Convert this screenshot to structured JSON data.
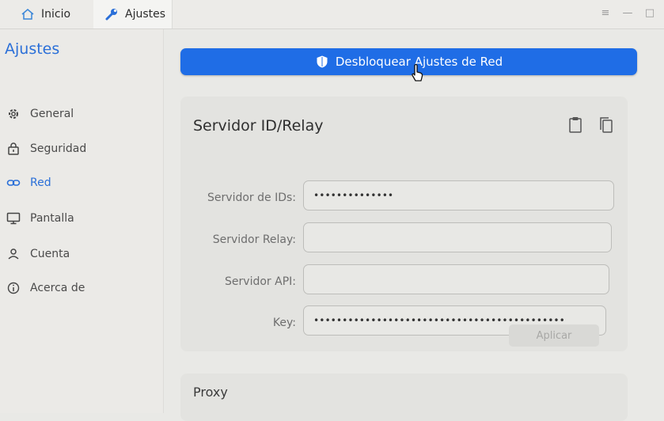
{
  "tabs": [
    {
      "label": "Inicio",
      "icon": "home-icon"
    },
    {
      "label": "Ajustes",
      "icon": "wrench-icon"
    }
  ],
  "window_controls": {
    "menu": "≡",
    "minimize": "—",
    "maximize": "□"
  },
  "sidebar": {
    "title": "Ajustes",
    "items": [
      {
        "label": "General",
        "icon": "gear-icon"
      },
      {
        "label": "Seguridad",
        "icon": "lock-icon"
      },
      {
        "label": "Red",
        "icon": "link-icon",
        "active": true
      },
      {
        "label": "Pantalla",
        "icon": "monitor-icon"
      },
      {
        "label": "Cuenta",
        "icon": "user-icon"
      },
      {
        "label": "Acerca de",
        "icon": "info-icon"
      }
    ]
  },
  "main": {
    "unlock_button": "Desbloquear Ajustes de Red",
    "server_card": {
      "title": "Servidor ID/Relay",
      "fields": [
        {
          "label": "Servidor de IDs:",
          "value": "••••••••••••••"
        },
        {
          "label": "Servidor Relay:",
          "value": ""
        },
        {
          "label": "Servidor API:",
          "value": ""
        },
        {
          "label": "Key:",
          "value": "••••••••••••••••••••••••••••••••••••••••••••"
        }
      ],
      "apply_button": "Aplicar"
    },
    "proxy_card": {
      "title": "Proxy"
    }
  },
  "colors": {
    "accent": "#1f6de6",
    "active_nav": "#2a6fd8"
  }
}
